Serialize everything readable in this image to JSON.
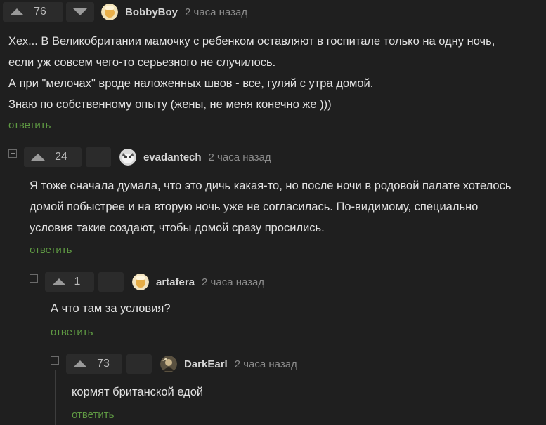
{
  "comments": [
    {
      "score": "76",
      "username": "BobbyBoy",
      "time": "2 часа назад",
      "lines": [
        "Хех... В Великобритании мамочку с ребенком оставляют в госпитале только на одну ночь,",
        "если уж совсем чего-то серьезного не случилось.",
        "А при \"мелочах\" вроде наложенных швов - все, гуляй с утра домой.",
        "Знаю по собственному опыту (жены, не меня конечно же )))"
      ],
      "reply_label": "ответить"
    },
    {
      "score": "24",
      "username": "evadantech",
      "time": "2 часа назад",
      "lines": [
        "Я тоже сначала думала, что это дичь какая-то, но после ночи в родовой палате хотелось",
        "домой побыстрее и на вторую ночь уже не согласилась. По-видимому, специально",
        "условия такие создают, чтобы домой сразу просились."
      ],
      "reply_label": "ответить"
    },
    {
      "score": "1",
      "username": "artafera",
      "time": "2 часа назад",
      "lines": [
        "А что там за условия?"
      ],
      "reply_label": "ответить"
    },
    {
      "score": "73",
      "username": "DarkEarl",
      "time": "2 часа назад",
      "lines": [
        "кормят британской едой"
      ],
      "reply_label": "ответить"
    }
  ],
  "icons": {
    "upvote": "upvote-arrow-icon",
    "downvote": "downvote-arrow-icon",
    "collapse": "collapse-thread-icon",
    "avatar": "user-avatar-icon"
  },
  "colors": {
    "background": "#1f1f1f",
    "reply_link": "#5f9a43",
    "text": "#e2e2e2",
    "muted": "#8c8c8c"
  }
}
